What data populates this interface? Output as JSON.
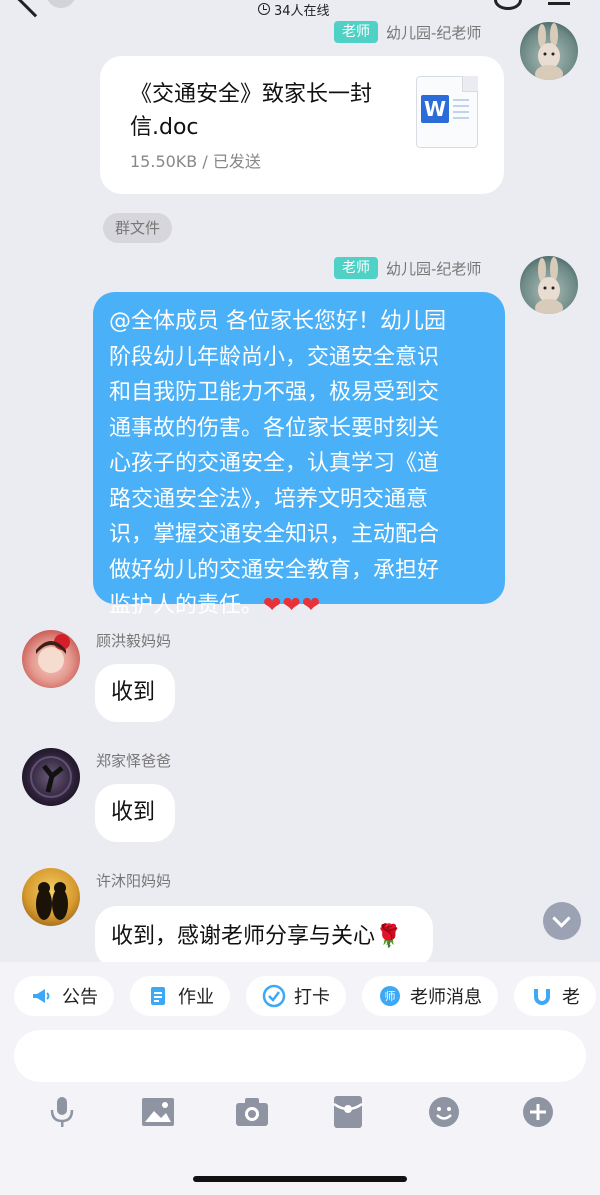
{
  "header": {
    "online_count": "34人在线"
  },
  "messages": [
    {
      "id": "file",
      "sender_badge": "老师",
      "sender_name": "幼儿园-纪老师",
      "file_title": "《交通安全》致家长一封信.doc",
      "file_meta": "15.50KB / 已发送",
      "file_icon_letter": "W",
      "tag": "群文件"
    },
    {
      "id": "announcement",
      "sender_badge": "老师",
      "sender_name": "幼儿园-纪老师",
      "text_lines": [
        "@全体成员 各位家长您好！幼儿园",
        "阶段幼儿年龄尚小，交通安全意识",
        "和自我防卫能力不强，极易受到交",
        "通事故的伤害。各位家长要时刻关",
        "心孩子的交通安全，认真学习《道",
        "路交通安全法》，培养文明交通意",
        "识，掌握交通安全知识，主动配合",
        "做好幼儿的交通安全教育，承担好",
        "监护人的责任。"
      ],
      "hearts": "❤❤❤"
    },
    {
      "id": "reply1",
      "sender_name": "顾洪毅妈妈",
      "text": "收到"
    },
    {
      "id": "reply2",
      "sender_name": "郑家怿爸爸",
      "text": "收到"
    },
    {
      "id": "reply3",
      "sender_name": "许沐阳妈妈",
      "text": "收到，感谢老师分享与关心🌹"
    }
  ],
  "quick_actions": [
    {
      "label": "公告",
      "icon": "megaphone-icon"
    },
    {
      "label": "作业",
      "icon": "document-icon"
    },
    {
      "label": "打卡",
      "icon": "check-circle-icon"
    },
    {
      "label": "老师消息",
      "icon": "teacher-icon"
    },
    {
      "label": "老",
      "icon": "magnet-icon"
    }
  ],
  "input": {
    "placeholder": ""
  },
  "toolbar": [
    "microphone-icon",
    "image-icon",
    "camera-icon",
    "red-packet-icon",
    "emoji-icon",
    "plus-icon"
  ],
  "colors": {
    "background": "#ebebf2",
    "blue_bubble": "#4ab0f7",
    "teacher_badge": "#4fd1c5",
    "heart": "#e8323a"
  }
}
